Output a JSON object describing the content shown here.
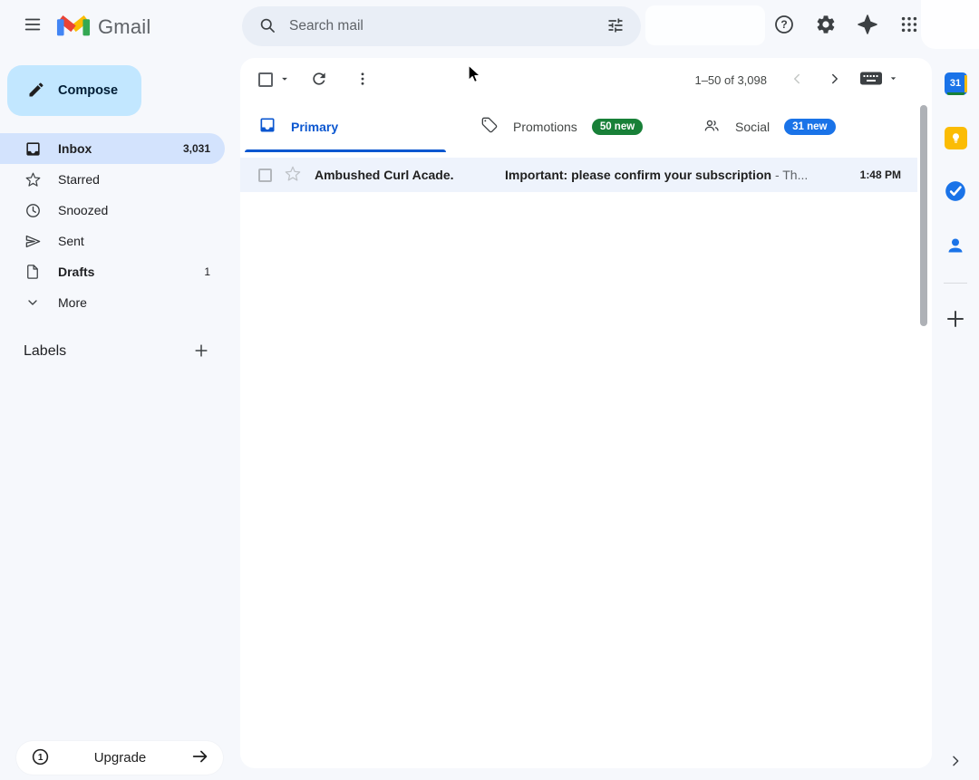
{
  "header": {
    "app_name": "Gmail",
    "search": {
      "placeholder": "Search mail"
    },
    "action_icons": [
      "help-icon",
      "settings-gear-icon",
      "gemini-icon",
      "apps-grid-icon"
    ]
  },
  "sidebar": {
    "compose_label": "Compose",
    "items": [
      {
        "label": "Inbox",
        "count": "3,031",
        "icon": "inbox-icon",
        "selected": true
      },
      {
        "label": "Starred",
        "count": "",
        "icon": "star-icon",
        "selected": false
      },
      {
        "label": "Snoozed",
        "count": "",
        "icon": "clock-icon",
        "selected": false
      },
      {
        "label": "Sent",
        "count": "",
        "icon": "send-icon",
        "selected": false
      },
      {
        "label": "Drafts",
        "count": "1",
        "icon": "draft-icon",
        "selected": false
      },
      {
        "label": "More",
        "count": "",
        "icon": "chevron-down-icon",
        "selected": false
      }
    ],
    "labels_header": "Labels",
    "upgrade": {
      "label": "Upgrade",
      "icon": "google-one-icon"
    }
  },
  "list_toolbar": {
    "pagination": "1–50 of 3,098"
  },
  "tabs": [
    {
      "label": "Primary",
      "badge": "",
      "selected": true
    },
    {
      "label": "Promotions",
      "badge": "50 new",
      "selected": false
    },
    {
      "label": "Social",
      "badge": "31 new",
      "selected": false
    }
  ],
  "emails": [
    {
      "sender": "Ambushed Curl Acade.",
      "subject": "Important: please confirm your subscription",
      "snippet": "- Th...",
      "time": "1:48 PM",
      "unread": true
    }
  ],
  "right_rail": {
    "calendar_day": "31",
    "icons": [
      "calendar-icon",
      "keep-icon",
      "tasks-icon",
      "contacts-icon",
      "add-icon",
      "expand-panel-icon"
    ]
  },
  "colors": {
    "background": "#f6f8fc",
    "surface": "#ffffff",
    "compose_button": "#c2e7ff",
    "selected_item": "#d3e3fd",
    "primary_blue": "#0b57d0",
    "promotions_badge_green": "#188038",
    "social_badge_blue": "#1a73e8",
    "unread_row": "#eef3fc",
    "text_primary": "#1f1f1f",
    "text_secondary": "#5f6368"
  }
}
